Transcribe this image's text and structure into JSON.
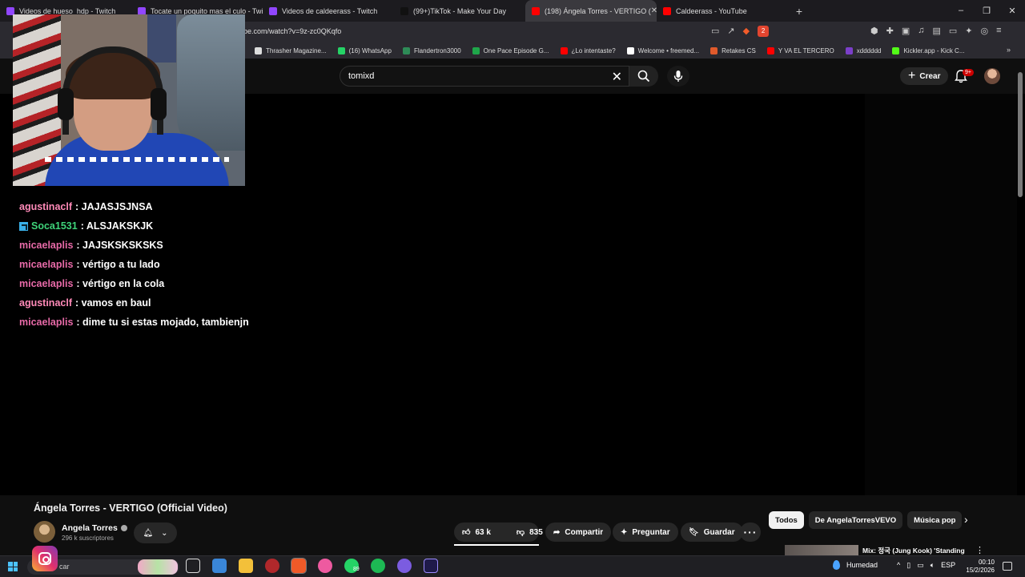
{
  "browser": {
    "tabs": [
      {
        "title": "Videos de hueso_hdp - Twitch",
        "color": "#9146ff",
        "active": false
      },
      {
        "title": "Tocate un poquito mas el culo - Twitc",
        "color": "#9146ff",
        "active": false
      },
      {
        "title": "Videos de caldeerass - Twitch",
        "color": "#9146ff",
        "active": false
      },
      {
        "title": "(99+)TikTok - Make Your Day",
        "color": "#111111",
        "active": false
      },
      {
        "title": "(198) Ángela Torres - VERTIGO (",
        "color": "#ff0000",
        "active": true
      },
      {
        "title": "Caldeerass - YouTube",
        "color": "#ff0000",
        "active": false
      }
    ],
    "new_tab": "+",
    "url": "be.com/watch?v=9z-zc0QKqfo",
    "shield_badge": "2",
    "window_controls": {
      "minimize": "–",
      "restore": "❐",
      "close": "✕"
    },
    "bookmarks": [
      {
        "label": "Thrasher Magazine...",
        "color": "#dddddd"
      },
      {
        "label": "(16) WhatsApp",
        "color": "#25d366"
      },
      {
        "label": "Flandertron3000",
        "color": "#2e8b57"
      },
      {
        "label": "One Pace Episode G...",
        "color": "#1fa64a"
      },
      {
        "label": "¿Lo intentaste?",
        "color": "#ff0000"
      },
      {
        "label": "Welcome • freemed...",
        "color": "#ffffff"
      },
      {
        "label": "Retakes CS",
        "color": "#e05a2b"
      },
      {
        "label": "Y VA EL TERCERO",
        "color": "#ff0000"
      },
      {
        "label": "xdddddd",
        "color": "#7b3fc9"
      },
      {
        "label": "Kickler.app - Kick C...",
        "color": "#53fc18"
      }
    ],
    "bookmarks_more": "»"
  },
  "youtube": {
    "search_value": "tomixd",
    "create_label": "Crear",
    "notifications_count": "9+",
    "video_title": "Ángela Torres - VERTIGO (Official Video)",
    "channel_name": "Angela Torres",
    "subscribers": "296 k suscriptores",
    "likes": "63 k",
    "dislikes": "835",
    "share_label": "Compartir",
    "ask_label": "Preguntar",
    "save_label": "Guardar",
    "chips": [
      {
        "label": "Todos",
        "active": true
      },
      {
        "label": "De AngelaTorresVEVO",
        "active": false
      },
      {
        "label": "Música pop",
        "active": false
      }
    ],
    "recommendation_title": "Mix: 정국 (Jung Kook) 'Standing"
  },
  "stream_chat": [
    {
      "user": "agustinaclf",
      "color": "#ff8ab8",
      "message": ": JAJASJSJNSA",
      "badge": false
    },
    {
      "user": "Soca1531",
      "color": "#3fd37a",
      "message": ": ALSJAKSKJK",
      "badge": true
    },
    {
      "user": "micaelaplis",
      "color": "#e86aa8",
      "message": ": JAJSKSKSKSKS",
      "badge": false
    },
    {
      "user": "micaelaplis",
      "color": "#e86aa8",
      "message": ": vértigo a tu lado",
      "badge": false
    },
    {
      "user": "micaelaplis",
      "color": "#e86aa8",
      "message": ": vértigo en la cola",
      "badge": false
    },
    {
      "user": "agustinaclf",
      "color": "#ff8ab8",
      "message": ": vamos en baul",
      "badge": false
    },
    {
      "user": "micaelaplis",
      "color": "#e86aa8",
      "message": ": dime tu si estas mojado, tambienjn",
      "badge": false
    }
  ],
  "taskbar": {
    "search_placeholder": "car",
    "whatsapp_count": "89",
    "weather": "Humedad",
    "language": "ESP",
    "time": "00:10",
    "date": "15/2/2026"
  }
}
